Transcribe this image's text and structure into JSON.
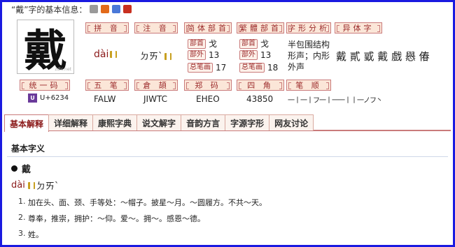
{
  "header": {
    "title": "“戴”字的基本信息：",
    "icons": [
      "print-icon",
      "simplified-icon",
      "traditional-icon",
      "mixed-icon"
    ]
  },
  "character": {
    "glyph": "戴",
    "watermark": "zdic.net"
  },
  "pinyin": {
    "label": "拼 音",
    "value": "dài"
  },
  "zhuyin": {
    "label": "注 音",
    "value": "ㄉㄞˋ"
  },
  "simplified_radical": {
    "label": "简体部首",
    "radical_tag": "部首",
    "radical": "戈",
    "outer_tag": "部外",
    "outer": "13",
    "total_tag": "总笔画",
    "total": "17"
  },
  "traditional_radical": {
    "label": "繁體部首",
    "radical_tag": "部首",
    "radical": "戈",
    "outer_tag": "部外",
    "outer": "13",
    "total_tag": "总笔画",
    "total": "18"
  },
  "structure": {
    "label": "字形分析",
    "line1": "半包围结构",
    "line2": "形声；内形",
    "line3": "外声"
  },
  "variants": {
    "label": "异体字",
    "value": "戴 貳 戜 戴 戲 㦛 偆"
  },
  "unicode": {
    "label": "统一码",
    "value": "U+6234"
  },
  "wubi": {
    "label": "五 笔",
    "value": "FALW"
  },
  "cangjie": {
    "label": "倉 頡",
    "value": "JIWTC"
  },
  "zhengma": {
    "label": "郑 码",
    "value": "EHEO"
  },
  "sijiao": {
    "label": "四 角",
    "value": "43850"
  },
  "bishun": {
    "label": "笔 顺",
    "value": "一丨一丨フ一丨一一丨丨一ノフ丶"
  },
  "tabs": [
    "基本解释",
    "详细解释",
    "康熙字典",
    "说文解字",
    "音韵方言",
    "字源字形",
    "网友讨论"
  ],
  "content": {
    "section_title": "基本字义",
    "entry_char": "戴",
    "reading_pinyin": "dài",
    "reading_zhuyin": "ㄉㄞˋ",
    "definitions": [
      {
        "n": "1.",
        "text": "加在头、面、颈、手等处：～帽子。披星～月。～圆履方。不共～天。"
      },
      {
        "n": "2.",
        "text": "尊奉，推崇，拥护：～仰。爱～。拥～。感恩～德。"
      },
      {
        "n": "3.",
        "text": "姓。"
      }
    ]
  }
}
